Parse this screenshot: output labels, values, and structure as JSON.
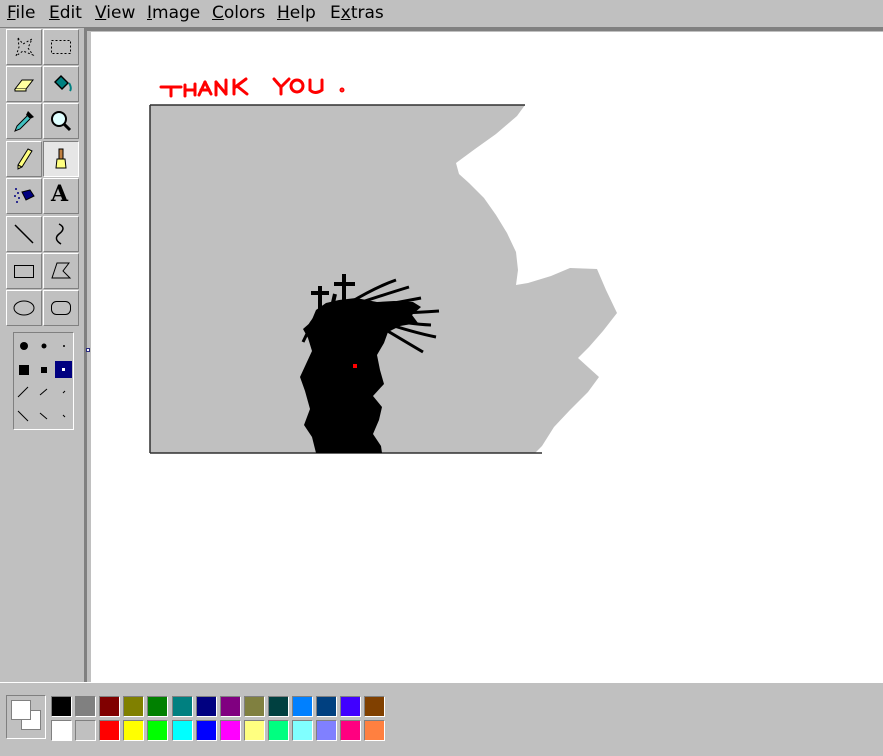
{
  "menubar": {
    "items": [
      {
        "label": "File",
        "mnemonic": "F"
      },
      {
        "label": "Edit",
        "mnemonic": "E"
      },
      {
        "label": "View",
        "mnemonic": "V"
      },
      {
        "label": "Image",
        "mnemonic": "I"
      },
      {
        "label": "Colors",
        "mnemonic": "C"
      },
      {
        "label": "Help",
        "mnemonic": "H"
      },
      {
        "label": "Extras",
        "mnemonic": "x"
      }
    ]
  },
  "toolbox": {
    "tools": [
      {
        "name": "free-form-select",
        "icon": "free-form-select-icon",
        "selected": false
      },
      {
        "name": "rectangle-select",
        "icon": "rectangle-select-icon",
        "selected": false
      },
      {
        "name": "eraser",
        "icon": "eraser-icon",
        "selected": false
      },
      {
        "name": "fill-with-color",
        "icon": "paint-bucket-icon",
        "selected": false
      },
      {
        "name": "pick-color",
        "icon": "eyedropper-icon",
        "selected": false
      },
      {
        "name": "magnifier",
        "icon": "magnifier-icon",
        "selected": false
      },
      {
        "name": "pencil",
        "icon": "pencil-icon",
        "selected": false
      },
      {
        "name": "brush",
        "icon": "brush-icon",
        "selected": true
      },
      {
        "name": "airbrush",
        "icon": "airbrush-icon",
        "selected": false
      },
      {
        "name": "text",
        "icon": "text-a-icon",
        "selected": false,
        "glyph": "A"
      },
      {
        "name": "line",
        "icon": "line-icon",
        "selected": false
      },
      {
        "name": "curve",
        "icon": "curve-icon",
        "selected": false
      },
      {
        "name": "rectangle",
        "icon": "rectangle-icon",
        "selected": false
      },
      {
        "name": "polygon",
        "icon": "polygon-icon",
        "selected": false
      },
      {
        "name": "ellipse",
        "icon": "ellipse-icon",
        "selected": false
      },
      {
        "name": "rounded-rectangle",
        "icon": "rounded-rectangle-icon",
        "selected": false
      }
    ],
    "brush_options_selected": "square-small-highlighted"
  },
  "canvas": {
    "handwritten_text": "THANK YOU ."
  },
  "colors": {
    "foreground": "#ffffff",
    "background": "#ffffff",
    "palette_top": [
      "#000000",
      "#808080",
      "#800000",
      "#808000",
      "#008000",
      "#008080",
      "#000080",
      "#800080",
      "#808040",
      "#004040",
      "#0080ff",
      "#004080",
      "#4000ff",
      "#804000"
    ],
    "palette_bottom": [
      "#ffffff",
      "#c0c0c0",
      "#ff0000",
      "#ffff00",
      "#00ff00",
      "#00ffff",
      "#0000ff",
      "#ff00ff",
      "#ffff80",
      "#00ff80",
      "#80ffff",
      "#8080ff",
      "#ff0080",
      "#ff8040"
    ]
  }
}
